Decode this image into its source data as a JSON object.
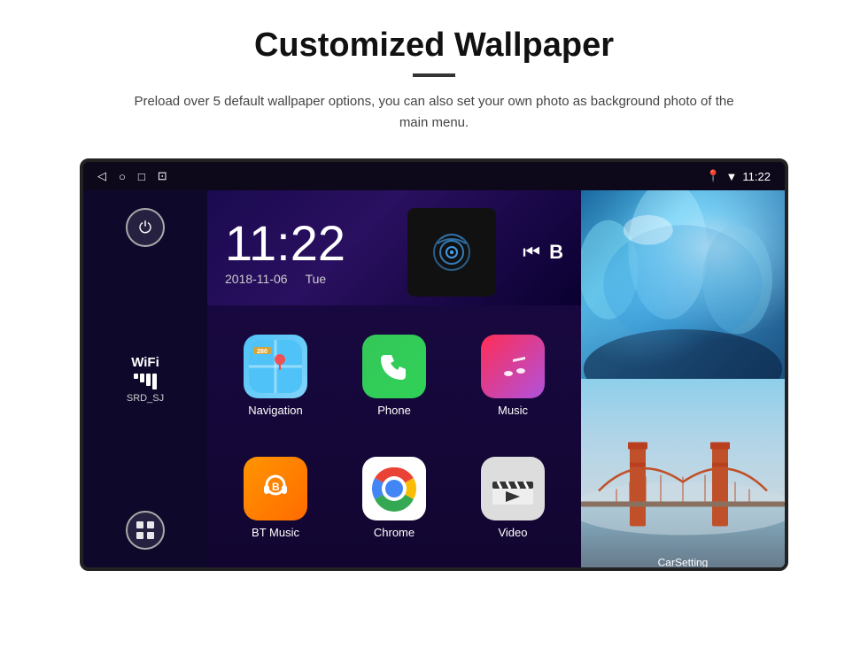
{
  "page": {
    "title": "Customized Wallpaper",
    "divider": true,
    "description": "Preload over 5 default wallpaper options, you can also set your own photo as background photo of the main menu."
  },
  "statusbar": {
    "back_icon": "◁",
    "home_icon": "○",
    "recents_icon": "□",
    "screenshot_icon": "⊡",
    "location_icon": "📍",
    "wifi_icon": "▼",
    "time": "11:22"
  },
  "sidebar": {
    "power_icon": "⏻",
    "wifi_label": "WiFi",
    "wifi_ssid": "SRD_SJ",
    "apps_icon": "⊞"
  },
  "clock": {
    "time": "11:22",
    "date": "2018-11-06",
    "day": "Tue"
  },
  "apps": [
    {
      "id": "navigation",
      "label": "Navigation",
      "icon_type": "nav"
    },
    {
      "id": "phone",
      "label": "Phone",
      "icon_type": "phone"
    },
    {
      "id": "music",
      "label": "Music",
      "icon_type": "music"
    },
    {
      "id": "bt_music",
      "label": "BT Music",
      "icon_type": "bt"
    },
    {
      "id": "chrome",
      "label": "Chrome",
      "icon_type": "chrome"
    },
    {
      "id": "video",
      "label": "Video",
      "icon_type": "video"
    }
  ],
  "photos": {
    "top_alt": "Ice cave blue background",
    "bottom_alt": "Golden Gate Bridge"
  },
  "carsetting": {
    "label": "CarSetting"
  }
}
